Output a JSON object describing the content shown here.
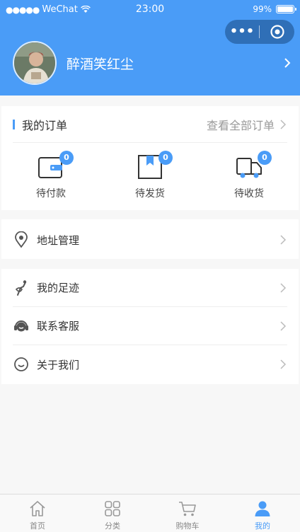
{
  "status_bar": {
    "carrier": "WeChat",
    "time": "23:00",
    "battery_text": "99%",
    "battery_level": 0.99
  },
  "profile": {
    "username": "醉酒笑红尘"
  },
  "orders": {
    "title": "我的订单",
    "view_all": "查看全部订单",
    "items": [
      {
        "label": "待付款",
        "badge": "0",
        "icon": "wallet-icon"
      },
      {
        "label": "待发货",
        "badge": "0",
        "icon": "package-icon"
      },
      {
        "label": "待收货",
        "badge": "0",
        "icon": "truck-icon"
      }
    ]
  },
  "address": {
    "label": "地址管理",
    "icon": "location-pin-icon"
  },
  "services": [
    {
      "label": "我的足迹",
      "icon": "footprint-icon"
    },
    {
      "label": "联系客服",
      "icon": "headset-icon"
    },
    {
      "label": "关于我们",
      "icon": "smile-icon"
    }
  ],
  "tabbar": [
    {
      "label": "首页",
      "icon": "home-icon",
      "active": false
    },
    {
      "label": "分类",
      "icon": "grid-icon",
      "active": false
    },
    {
      "label": "购物车",
      "icon": "cart-icon",
      "active": false
    },
    {
      "label": "我的",
      "icon": "user-icon",
      "active": true
    }
  ],
  "colors": {
    "primary": "#4a9cf7",
    "capsule": "#2f6fb7",
    "background": "#f7f7f7"
  }
}
